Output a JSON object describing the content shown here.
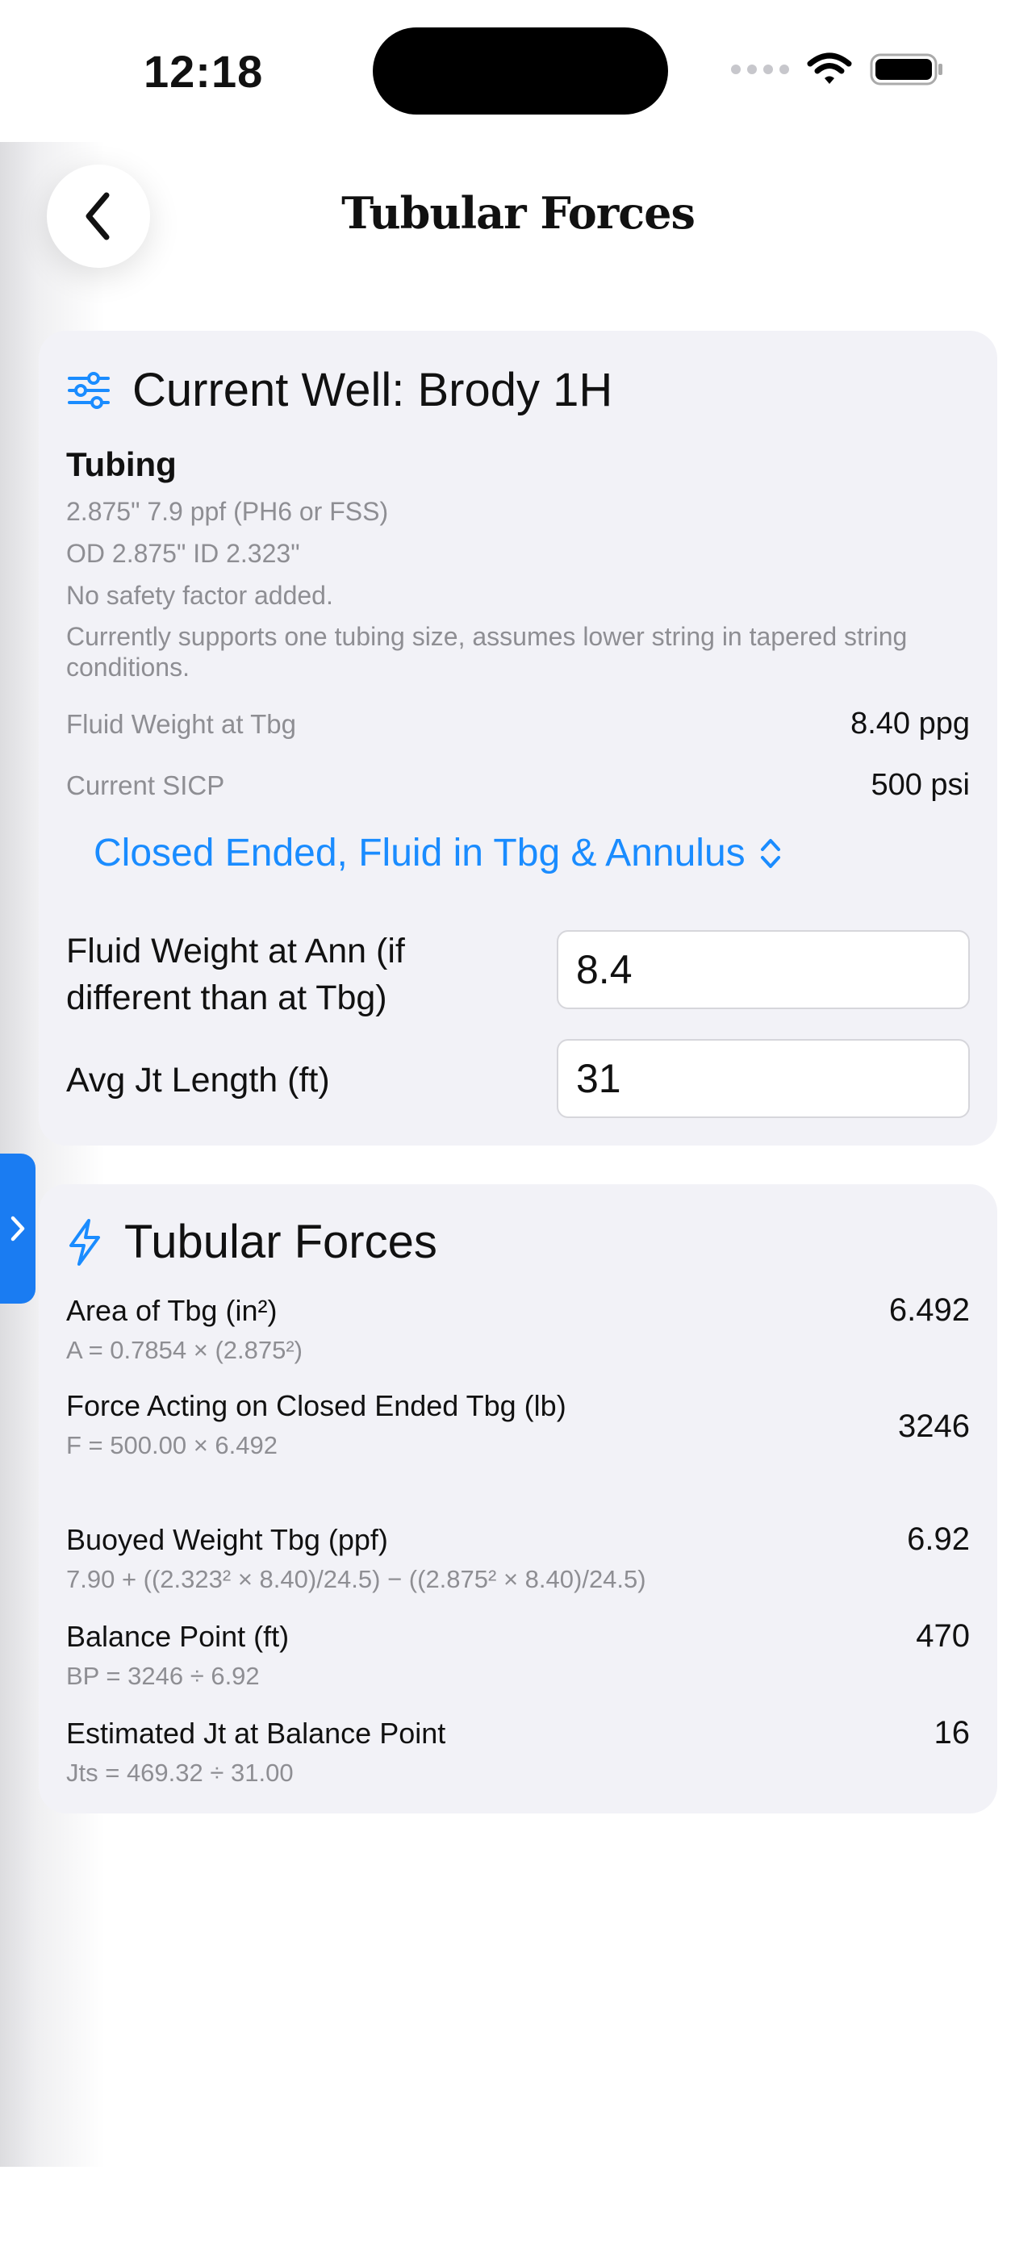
{
  "status_bar": {
    "time": "12:18"
  },
  "header": {
    "title": "Tubular Forces"
  },
  "well_card": {
    "heading": "Current Well: Brody 1H",
    "section_label": "Tubing",
    "lines": [
      "2.875\" 7.9 ppf (PH6 or FSS)",
      "OD 2.875\"  ID 2.323\"",
      "No safety factor added.",
      "Currently supports one tubing size, assumes lower string in tapered string conditions."
    ],
    "fluid_weight_tbg_label": "Fluid Weight at Tbg",
    "fluid_weight_tbg_value": "8.40 ppg",
    "sicp_label": "Current SICP",
    "sicp_value": "500 psi",
    "picker_value": "Closed Ended, Fluid in Tbg & Annulus",
    "fluid_ann_label": "Fluid Weight at Ann (if different than at Tbg)",
    "fluid_ann_value": "8.4",
    "jt_length_label": "Avg Jt Length (ft)",
    "jt_length_value": "31"
  },
  "forces_card": {
    "heading": "Tubular Forces",
    "metrics": [
      {
        "name": "Area of Tbg (in²)",
        "formula": "A = 0.7854 × (2.875²)",
        "value": "6.492"
      },
      {
        "name": "Force Acting on Closed Ended Tbg (lb)",
        "formula": "F = 500.00 × 6.492",
        "value": "3246"
      },
      {
        "name": "Buoyed Weight Tbg (ppf)",
        "formula": "7.90 + ((2.323² × 8.40)/24.5) − ((2.875² × 8.40)/24.5)",
        "value": "6.92"
      },
      {
        "name": "Balance Point (ft)",
        "formula": "BP = 3246 ÷ 6.92",
        "value": "470"
      },
      {
        "name": "Estimated Jt at Balance Point",
        "formula": "Jts = 469.32 ÷ 31.00",
        "value": "16"
      }
    ]
  },
  "colors": {
    "accent": "#1a8cff",
    "card_bg": "#f2f2f7",
    "secondary_text": "#8e8e93"
  },
  "icons": [
    "back-chevron-icon",
    "sliders-icon",
    "updown-chevron-icon",
    "bolt-icon",
    "chevron-right-icon",
    "wifi-icon",
    "battery-icon"
  ]
}
